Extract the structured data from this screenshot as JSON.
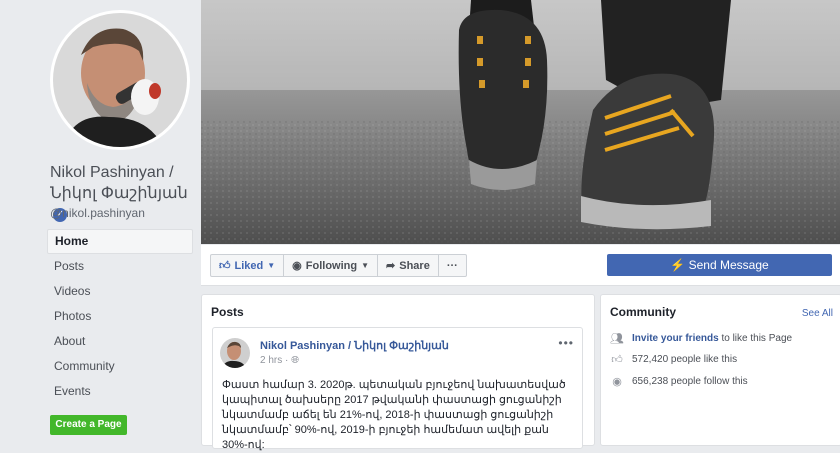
{
  "profile": {
    "name_line1": "Nikol Pashinyan /",
    "name_line2": "Նիկոլ Փաշինյան",
    "handle": "@nikol.pashinyan"
  },
  "nav": {
    "items": [
      {
        "label": "Home",
        "active": true
      },
      {
        "label": "Posts"
      },
      {
        "label": "Videos"
      },
      {
        "label": "Photos"
      },
      {
        "label": "About"
      },
      {
        "label": "Community"
      },
      {
        "label": "Events"
      }
    ],
    "create_page": "Create a Page"
  },
  "actions": {
    "liked": "Liked",
    "following": "Following",
    "share": "Share",
    "more": "···",
    "send_message": "Send Message"
  },
  "posts": {
    "title": "Posts",
    "post": {
      "author": "Nikol Pashinyan / Նիկոլ Փաշինյան",
      "time": "2 hrs",
      "more": "•••",
      "text": "Փաստ համար 3. 2020թ. պետական բյուջեով նախատեսված կապիտալ ծախսերը 2017 թվականի փաստացի ցուցանիշի նկատմամբ աճել են 21%-ով, 2018-ի փաստացի ցուցանիշի նկատմամբ՝ 90%-ով, 2019-ի բյուջեի համեմատ ավելի քան 30%-ով:"
    }
  },
  "community": {
    "title": "Community",
    "see_all": "See All",
    "invite_link": "Invite your friends",
    "invite_rest": "to like this Page",
    "likes": "572,420 people like this",
    "follows": "656,238 people follow this"
  },
  "colors": {
    "accent": "#4267b2",
    "link": "#365899",
    "create_button": "#42b72a",
    "background": "#e9ebee"
  }
}
